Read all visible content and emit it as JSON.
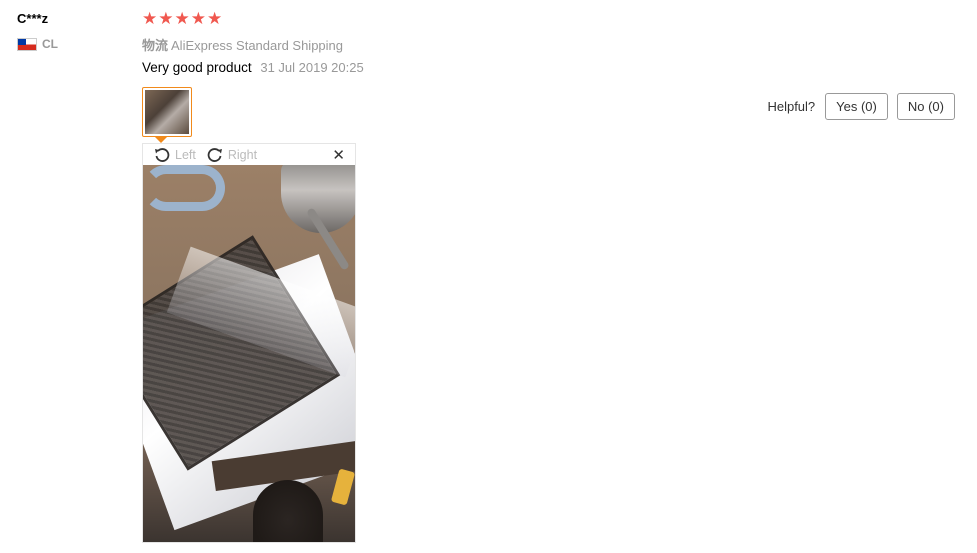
{
  "user": {
    "name": "C***z",
    "country_code": "CL",
    "flag_icon": "chile-flag-icon"
  },
  "rating": {
    "stars": 5,
    "max": 5,
    "star_color": "#f0584f",
    "star_glyph": "★"
  },
  "shipping": {
    "label": "物流",
    "value": "AliExpress Standard Shipping"
  },
  "feedback": {
    "text": "Very good product",
    "date": "31 Jul 2019 20:25"
  },
  "photo_viewer": {
    "rotate_left_label": "Left",
    "rotate_right_label": "Right",
    "close_glyph": "✕",
    "accent_color": "#f18a1b"
  },
  "helpful": {
    "label": "Helpful?",
    "yes_label": "Yes (0)",
    "no_label": "No (0)"
  }
}
